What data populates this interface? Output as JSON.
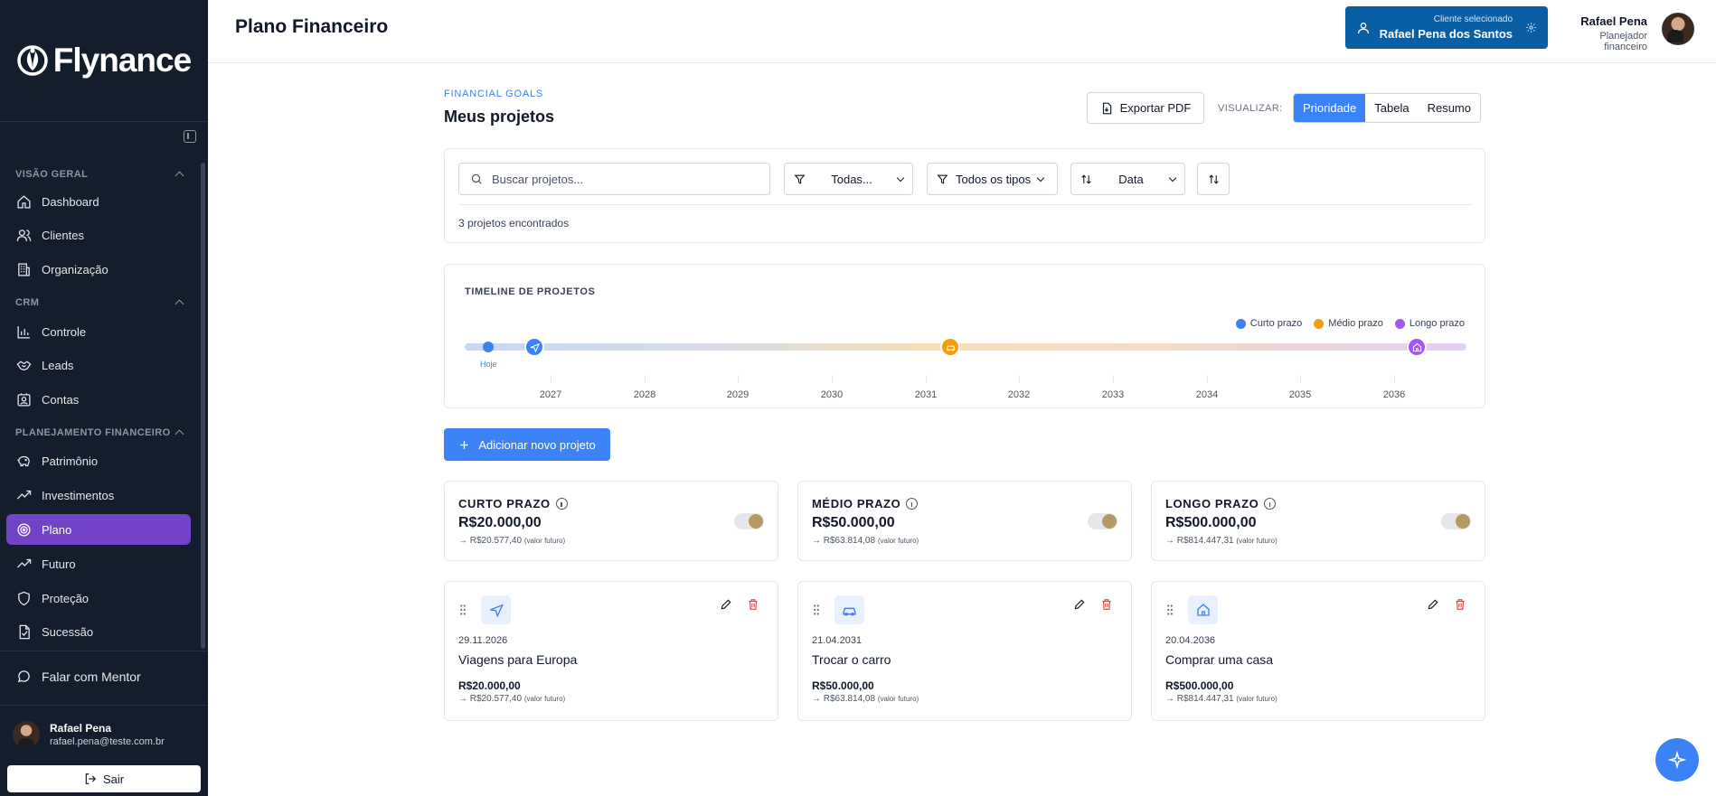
{
  "app": {
    "brand": "Flynance"
  },
  "sidebar": {
    "sections": [
      {
        "title": "VISÃO GERAL",
        "items": [
          "Dashboard",
          "Clientes",
          "Organização"
        ]
      },
      {
        "title": "CRM",
        "items": [
          "Controle",
          "Leads",
          "Contas"
        ]
      },
      {
        "title": "PLANEJAMENTO FINANCEIRO",
        "items": [
          "Patrimônio",
          "Investimentos",
          "Plano",
          "Futuro",
          "Proteção",
          "Sucessão"
        ]
      }
    ],
    "active_item": "Plano",
    "mentor": "Falar com Mentor",
    "user": {
      "name": "Rafael Pena",
      "email": "rafael.pena@teste.com.br"
    },
    "logout": "Sair"
  },
  "header": {
    "title": "Plano Financeiro",
    "client": {
      "label": "Cliente selecionado",
      "name": "Rafael Pena dos Santos"
    },
    "planner": {
      "name": "Rafael Pena",
      "role": "Planejador financeiro"
    }
  },
  "main": {
    "eyebrow": "FINANCIAL GOALS",
    "title": "Meus projetos",
    "export_label": "Exportar PDF",
    "view_label": "VISUALIZAR:",
    "views": [
      "Prioridade",
      "Tabela",
      "Resumo"
    ],
    "active_view": "Prioridade",
    "filters": {
      "search_placeholder": "Buscar projetos...",
      "status": "Todas...",
      "type": "Todos os tipos",
      "sort": "Data",
      "count_text": "3 projetos encontrados"
    },
    "timeline": {
      "title": "TIMELINE DE PROJETOS",
      "today_label": "Hoje",
      "legend": [
        {
          "label": "Curto prazo",
          "color": "#3b82f6"
        },
        {
          "label": "Médio prazo",
          "color": "#f59e0b"
        },
        {
          "label": "Longo prazo",
          "color": "#a855f7"
        }
      ],
      "years": [
        "2027",
        "2028",
        "2029",
        "2030",
        "2031",
        "2032",
        "2033",
        "2034",
        "2035",
        "2036"
      ]
    },
    "add_button": "Adicionar novo projeto",
    "summaries": [
      {
        "title": "CURTO PRAZO",
        "value": "R$20.000,00",
        "future": "→ R$20.577,40",
        "future_note": "(valor futuro)"
      },
      {
        "title": "MÉDIO PRAZO",
        "value": "R$50.000,00",
        "future": "→ R$63.814,08",
        "future_note": "(valor futuro)"
      },
      {
        "title": "LONGO PRAZO",
        "value": "R$500.000,00",
        "future": "→ R$814.447,31",
        "future_note": "(valor futuro)"
      }
    ],
    "projects": [
      {
        "icon": "airplane-icon",
        "date": "29.11.2026",
        "name": "Viagens para Europa",
        "value": "R$20.000,00",
        "future": "→ R$20.577,40",
        "future_note": "(valor futuro)"
      },
      {
        "icon": "car-icon",
        "date": "21.04.2031",
        "name": "Trocar o carro",
        "value": "R$50.000,00",
        "future": "→ R$63.814,08",
        "future_note": "(valor futuro)"
      },
      {
        "icon": "house-icon",
        "date": "20.04.2036",
        "name": "Comprar uma casa",
        "value": "R$500.000,00",
        "future": "→ R$814.447,31",
        "future_note": "(valor futuro)"
      }
    ]
  },
  "colors": {
    "sidebar_bg": "#141d2b",
    "active_nav": "#7143c9",
    "primary": "#3b82f6",
    "client_card": "#0a5ea4",
    "delete": "#ef4444"
  }
}
